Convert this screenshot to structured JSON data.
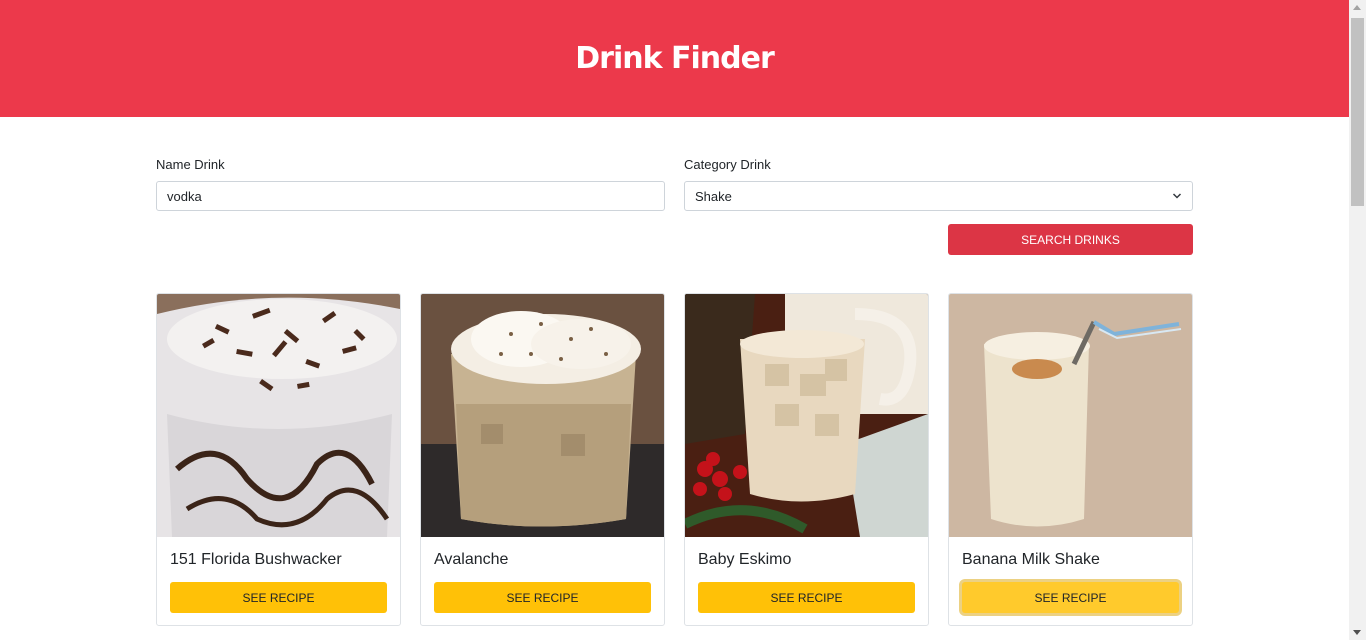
{
  "header": {
    "title": "Drink Finder"
  },
  "form": {
    "name_label": "Name Drink",
    "name_value": "vodka",
    "category_label": "Category Drink",
    "category_value": "Shake",
    "search_button": "SEARCH DRINKS"
  },
  "cards": [
    {
      "title": "151 Florida Bushwacker",
      "button": "SEE RECIPE"
    },
    {
      "title": "Avalanche",
      "button": "SEE RECIPE"
    },
    {
      "title": "Baby Eskimo",
      "button": "SEE RECIPE"
    },
    {
      "title": "Banana Milk Shake",
      "button": "SEE RECIPE"
    }
  ],
  "colors": {
    "header": "#ec394b",
    "search_button": "#dc3545",
    "recipe_button": "#ffc107"
  }
}
